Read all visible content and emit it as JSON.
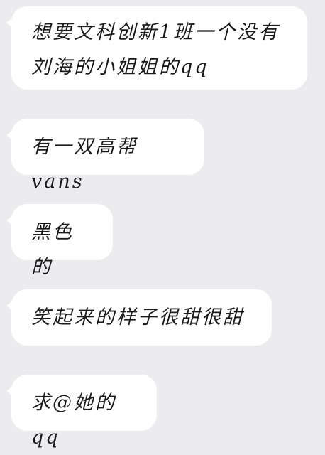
{
  "messages": [
    {
      "text": "想要文科创新1班一个没有刘海的小姐姐的qq"
    },
    {
      "text": "有一双高帮vans"
    },
    {
      "text": "黑色的"
    },
    {
      "text": "笑起来的样子很甜很甜"
    },
    {
      "text": "求@她的qq"
    }
  ],
  "colors": {
    "background": "#ececef",
    "bubble": "#ffffff",
    "text": "#1b1b1b"
  }
}
